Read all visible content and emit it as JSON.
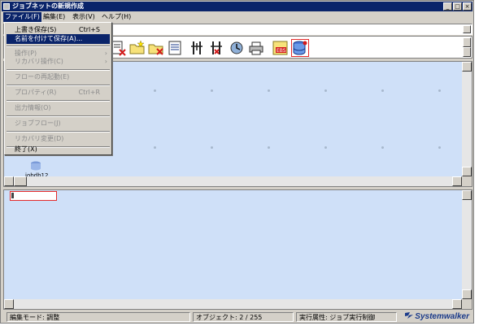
{
  "window": {
    "title": "ジョブネットの新規作成",
    "controls": [
      "minimize-icon",
      "maximize-icon",
      "close-icon"
    ]
  },
  "menubar": {
    "items": [
      {
        "label": "ファイル(F)"
      },
      {
        "label": "編集(E)"
      },
      {
        "label": "表示(V)"
      },
      {
        "label": "ヘルプ(H)"
      }
    ]
  },
  "file_menu": {
    "items": [
      {
        "label": "上書き保存(S)",
        "shortcut": "Ctrl+S"
      },
      {
        "label": "名前を付けて保存(A)...",
        "shortcut": ""
      },
      {
        "label": "操作(P)",
        "shortcut": ""
      },
      {
        "label": "リカバリ操作(C)",
        "shortcut": ""
      },
      {
        "label": "フローの再起動(E)",
        "shortcut": ""
      },
      {
        "label": "プロパティ(R)",
        "shortcut": "Ctrl+R"
      },
      {
        "label": "出力情報(O)",
        "shortcut": ""
      },
      {
        "label": "ジョブフロー(J)",
        "shortcut": ""
      },
      {
        "label": "リカバリ変更(D)",
        "shortcut": ""
      },
      {
        "label": "終了(X)",
        "shortcut": ""
      }
    ]
  },
  "toolbar": {
    "icons": [
      "job-delete-icon",
      "folder-new-icon",
      "folder-delete-icon",
      "document-icon",
      "branch-icon",
      "branch-delete-icon",
      "wait-icon",
      "print-icon",
      "ebs-icon",
      "database-icon"
    ]
  },
  "canvas": {
    "node_label": "jobdb12"
  },
  "statusbar": {
    "mode": "編集モード: 調整",
    "objects": "オブジェクト: 2 / 255",
    "attribute": "実行属性: ジョブ実行制御",
    "brand": "Systemwalker"
  },
  "colors": {
    "title_bar": "#0a246a",
    "canvas_bg": "#cfe0f8",
    "selection_outline": "#e32b2b",
    "menu_highlight": "#0a246a"
  }
}
